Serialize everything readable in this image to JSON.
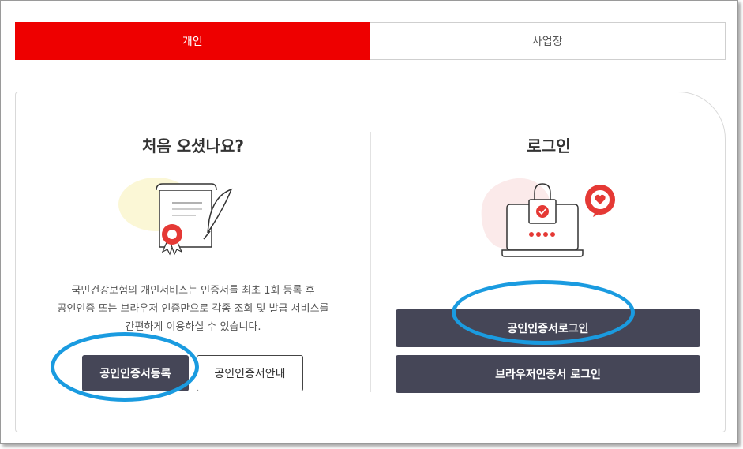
{
  "tabs": [
    {
      "label": "개인",
      "active": true
    },
    {
      "label": "사업장",
      "active": false
    }
  ],
  "new_user": {
    "title": "처음 오셨나요?",
    "desc_lines": [
      "국민건강보험의 개인서비스는 인증서를 최초 1회 등록 후",
      "공인인증 또는 브라우저 인증만으로 각종 조회 및 발급 서비스를",
      "간편하게 이용하실 수 있습니다."
    ],
    "register_button": "공인인증서등록",
    "guide_button": "공인인증서안내",
    "illustration_icon": "certificate-icon"
  },
  "login": {
    "title": "로그인",
    "cert_login_button": "공인인증서로그인",
    "browser_login_button": "브라우저인증서 로그인",
    "illustration_icon": "laptop-lock-icon"
  },
  "colors": {
    "accent_red": "#ee0000",
    "button_dark": "#454657",
    "highlight_blue": "#1a9be0"
  }
}
